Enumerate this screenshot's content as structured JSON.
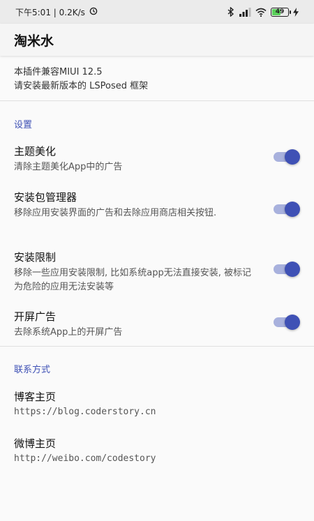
{
  "status_bar": {
    "time_speed": "下午5:01 | 0.2K/s",
    "battery_level": "49"
  },
  "app_bar": {
    "title": "淘米水"
  },
  "notice": {
    "line1": "本插件兼容MIUI 12.5",
    "line2": "请安装最新版本的 LSPosed 框架"
  },
  "settings": {
    "header": "设置",
    "items": [
      {
        "title": "主题美化",
        "summary": "清除主题美化App中的广告",
        "enabled": true
      },
      {
        "title": "安装包管理器",
        "summary": "移除应用安装界面的广告和去除应用商店相关按钮.",
        "enabled": true
      },
      {
        "title": "安装限制",
        "summary": "移除一些应用安装限制, 比如系统app无法直接安装, 被标记为危险的应用无法安装等",
        "enabled": true
      },
      {
        "title": "开屏广告",
        "summary": "去除系统App上的开屏广告",
        "enabled": true
      }
    ]
  },
  "contact": {
    "header": "联系方式",
    "items": [
      {
        "title": "博客主页",
        "url": "https://blog.coderstory.cn"
      },
      {
        "title": "微博主页",
        "url": "http://weibo.com/codestory"
      }
    ]
  },
  "colors": {
    "accent": "#3f51b5",
    "switch_track": "#a8b1dd",
    "status_bar_bg": "#ebebeb"
  }
}
